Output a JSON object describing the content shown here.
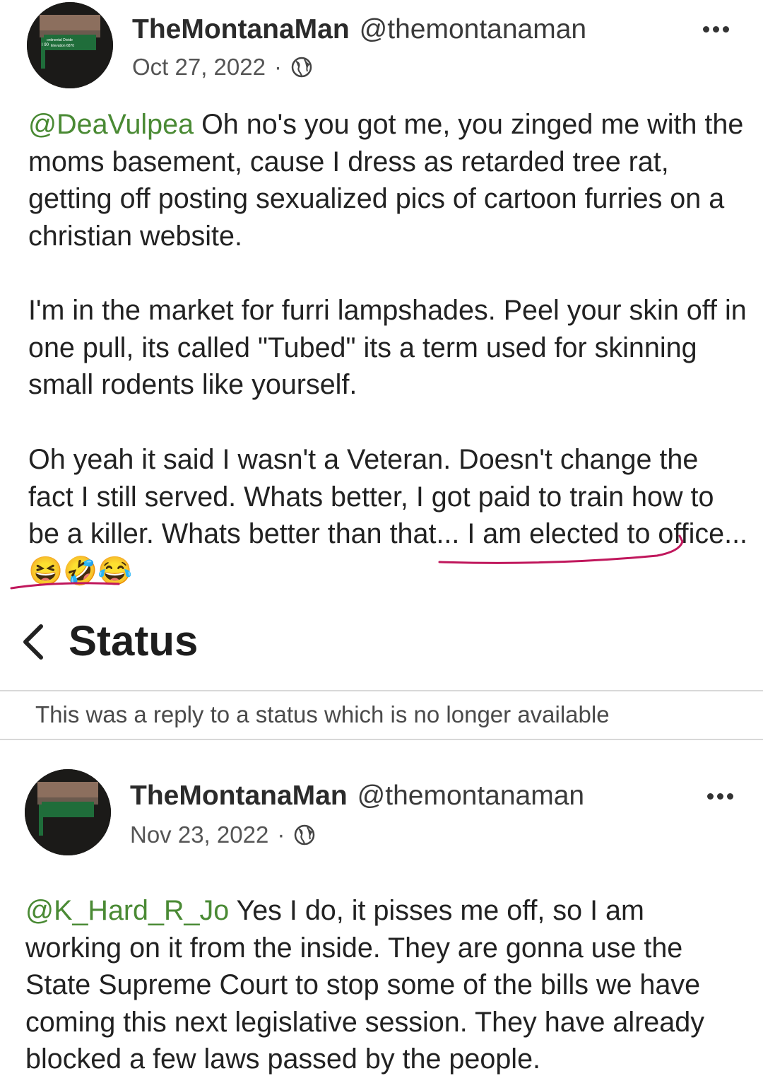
{
  "post1": {
    "display_name": "TheMontanaMan",
    "handle": "@themontanaman",
    "date": "Oct 27, 2022",
    "mention": "@DeaVulpea",
    "para1_rest": " Oh no's you got me, you zinged me with the moms basement, cause I dress as retarded tree rat, getting off posting sexualized pics of cartoon furries on a christian website.",
    "para2": "I'm in the market for furri lampshades. Peel your skin off in one pull, its called \"Tubed\" its a term used for skinning small rodents like yourself.",
    "para3": "Oh yeah it said I wasn't a Veteran. Doesn't change the fact I still served. Whats better, I got paid to train how to be a killer. Whats better than that... I am elected to office... 😆🤣😂",
    "avatar_sign_lines": [
      "ontinental Divide",
      "Elevation 6870",
      "I 90"
    ]
  },
  "status_header": {
    "title": "Status",
    "reply_note": "This was a reply to a status which is no longer available"
  },
  "post2": {
    "display_name": "TheMontanaMan",
    "handle": "@themontanaman",
    "date": "Nov 23, 2022",
    "mention": "@K_Hard_R_Jo",
    "body_rest": " Yes I do, it pisses me off, so I am working on it from the inside. They are gonna use the State Supreme Court to stop some of the bills we have coming this next legislative session. They have already blocked a few laws passed by the people."
  },
  "colors": {
    "mention": "#4a8a34",
    "annotation_underline": "#c0175c"
  },
  "icons": [
    "globe-icon",
    "more-options-icon",
    "back-chevron-icon"
  ]
}
